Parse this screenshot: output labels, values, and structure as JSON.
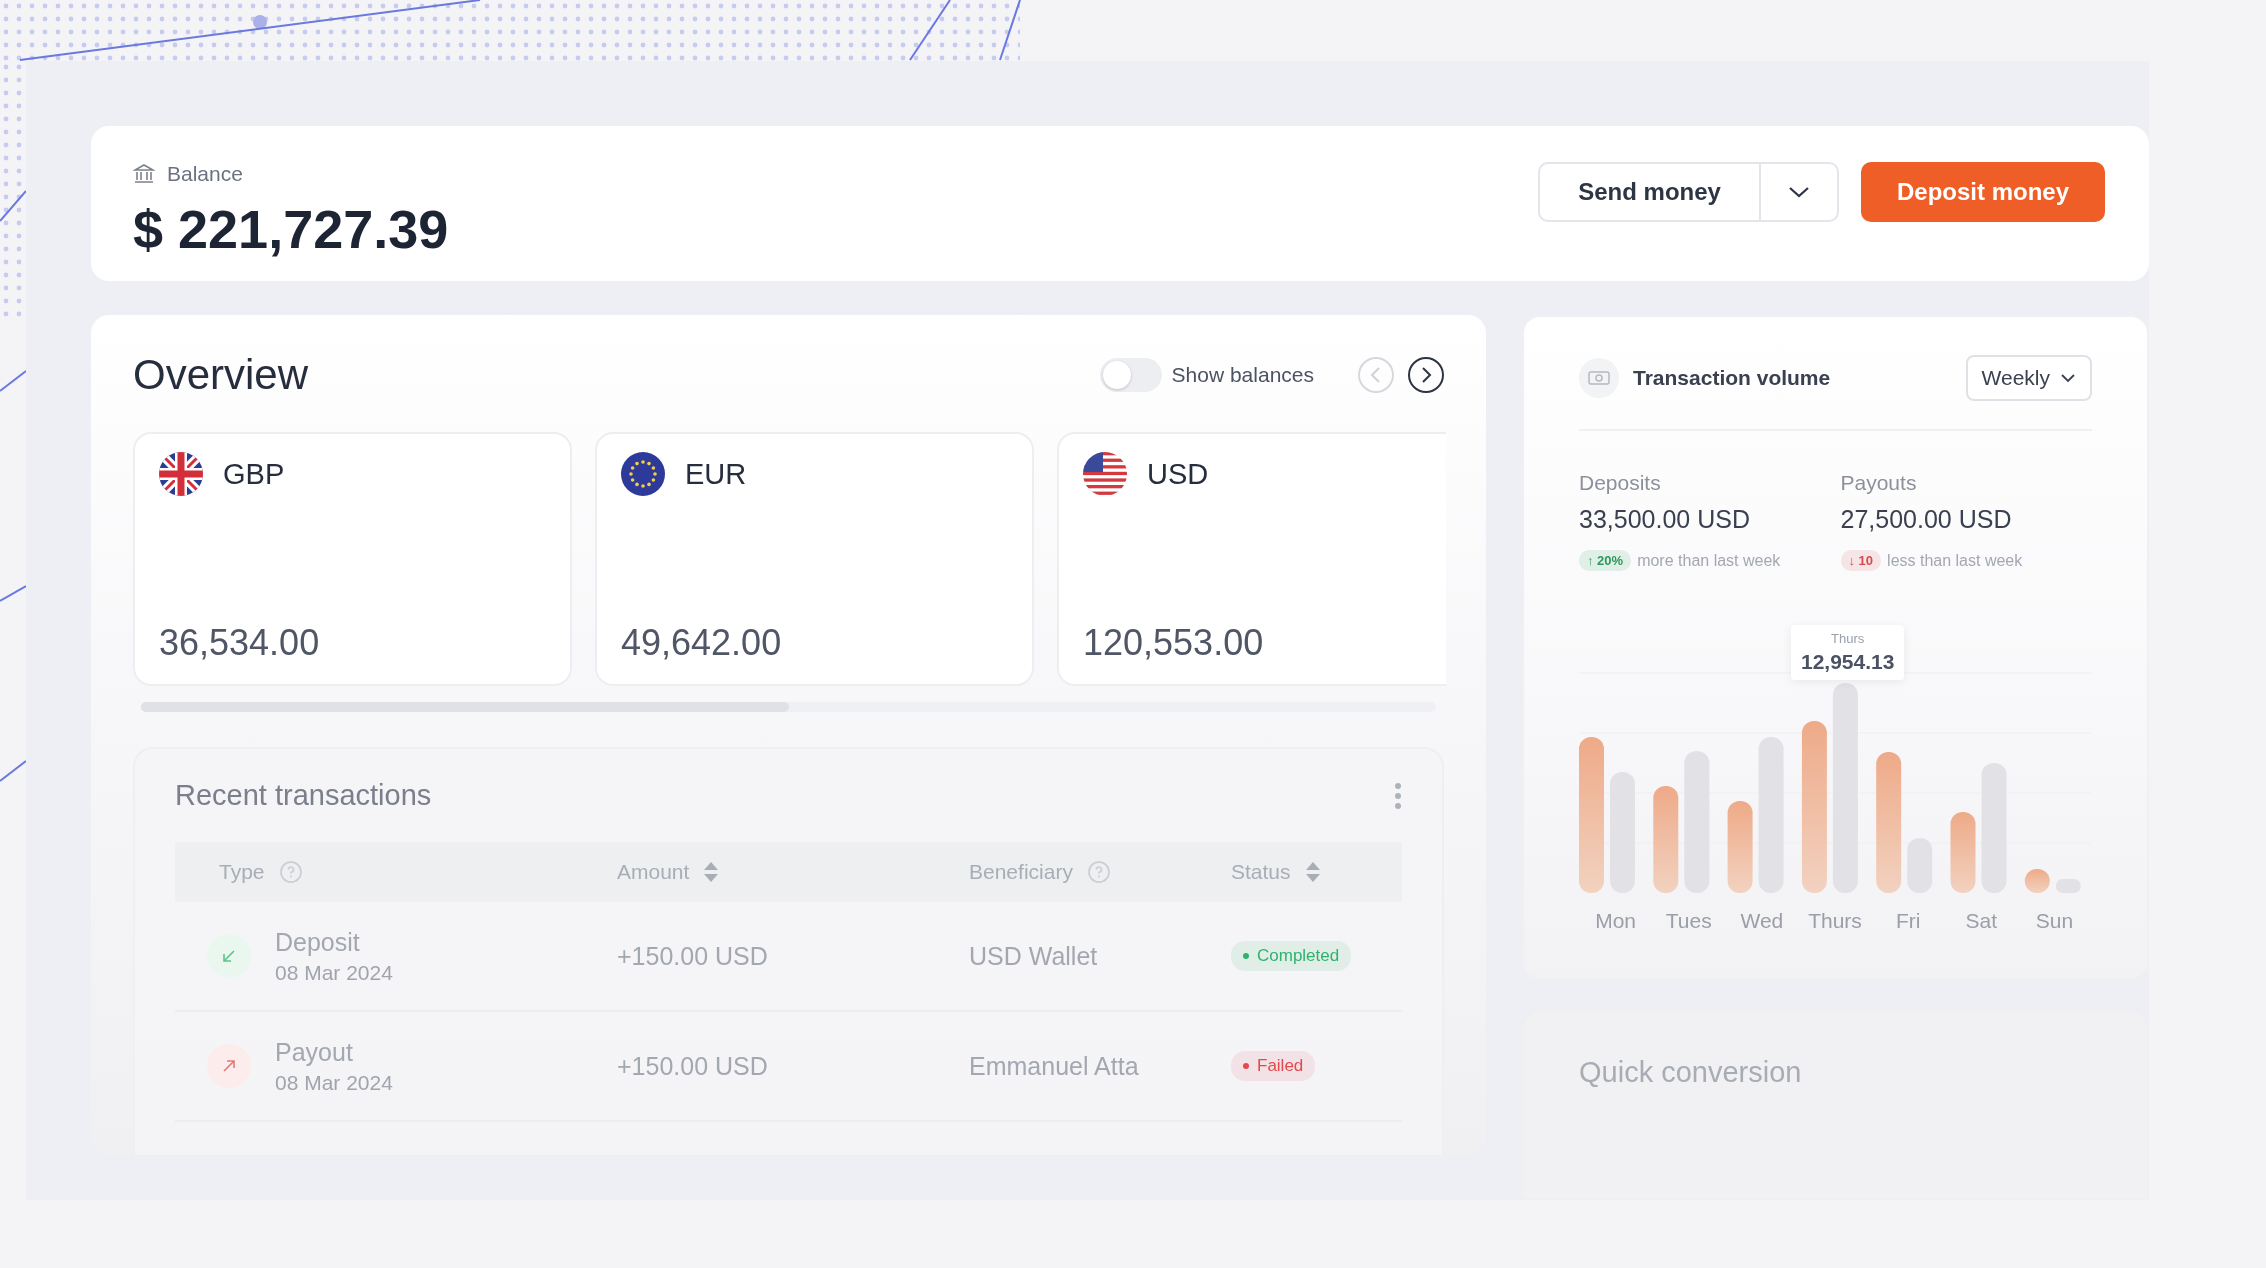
{
  "balance": {
    "label": "Balance",
    "amount": "$ 221,727.39"
  },
  "actions": {
    "send": "Send money",
    "deposit": "Deposit money"
  },
  "overview": {
    "title": "Overview",
    "show_balances": {
      "label": "Show balances",
      "on": false
    },
    "nav": [
      {
        "kind": "prev",
        "disabled": true
      },
      {
        "kind": "next",
        "disabled": false
      }
    ],
    "currencies": [
      {
        "code": "GBP",
        "kind": "gb",
        "amount": "36,534.00"
      },
      {
        "code": "EUR",
        "kind": "eu",
        "amount": "49,642.00"
      },
      {
        "code": "USD",
        "kind": "us",
        "amount": "120,553.00"
      }
    ]
  },
  "recent_transactions": {
    "title": "Recent transactions",
    "columns": [
      {
        "label": "Type",
        "kind": "help"
      },
      {
        "label": "Amount",
        "kind": "sort"
      },
      {
        "label": "Beneficiary",
        "kind": "help"
      },
      {
        "label": "Status",
        "kind": "sort"
      }
    ],
    "rows": [
      {
        "kind": "deposit",
        "type": "Deposit",
        "date": "08 Mar 2024",
        "amount": "+150.00 USD",
        "beneficiary": "USD Wallet",
        "status": "Completed",
        "color": "#2fb36b"
      },
      {
        "kind": "payout",
        "type": "Payout",
        "date": "08 Mar 2024",
        "amount": "+150.00 USD",
        "beneficiary": "Emmanuel Atta",
        "status": "Failed",
        "color": "#e5484d"
      }
    ]
  },
  "transaction_volume": {
    "title": "Transaction volume",
    "period": "Weekly",
    "stats": [
      {
        "label": "Deposits",
        "value": "33,500.00 USD",
        "change": "↑ 20%",
        "color": "#2c9a5a",
        "note": "more than last week"
      },
      {
        "label": "Payouts",
        "value": "27,500.00 USD",
        "change": "↓ 10",
        "color": "#d9484d",
        "note": "less than last week"
      }
    ],
    "tooltip": {
      "day": "Thurs",
      "value": "12,954.13"
    },
    "days": [
      "Mon",
      "Tues",
      "Wed",
      "Thurs",
      "Fri",
      "Sat",
      "Sun"
    ]
  },
  "quick_conversion": {
    "title": "Quick conversion"
  }
}
